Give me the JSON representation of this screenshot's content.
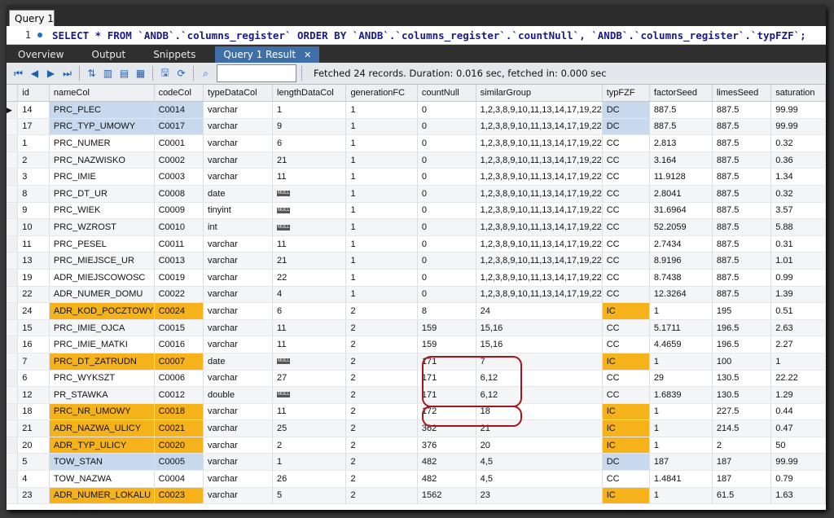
{
  "editor": {
    "tab_label": "Query 1",
    "line_number": "1",
    "sql": "SELECT * FROM `ANDB`.`columns_register` ORDER BY `ANDB`.`columns_register`.`countNull`, `ANDB`.`columns_register`.`typFZF`;"
  },
  "result_tabs": [
    "Overview",
    "Output",
    "Snippets"
  ],
  "active_result_tab": "Query 1 Result",
  "status": "Fetched 24 records. Duration: 0.016 sec, fetched in: 0.000 sec",
  "search": {
    "value": ""
  },
  "columns": [
    "id",
    "nameCol",
    "codeCol",
    "typeDataCol",
    "lengthDataCol",
    "generationFC",
    "countNull",
    "similarGroup",
    "typFZF",
    "factorSeed",
    "limesSeed",
    "saturation"
  ],
  "null_label": "NULL",
  "colors": {
    "highlight_blue": "#c8d9ee",
    "highlight_orange": "#f6b21a",
    "circle_red": "#a9141b"
  },
  "rows": [
    {
      "id": "14",
      "nameCol": "PRC_PLEC",
      "codeCol": "C0014",
      "typeDataCol": "varchar",
      "lengthDataCol": "1",
      "generationFC": "1",
      "countNull": "0",
      "similarGroup": "1,2,3,8,9,10,11,13,14,17,19,22",
      "typFZF": "DC",
      "factorSeed": "887.5",
      "limesSeed": "887.5",
      "saturation": "99.99",
      "hl": "blue"
    },
    {
      "id": "17",
      "nameCol": "PRC_TYP_UMOWY",
      "codeCol": "C0017",
      "typeDataCol": "varchar",
      "lengthDataCol": "9",
      "generationFC": "1",
      "countNull": "0",
      "similarGroup": "1,2,3,8,9,10,11,13,14,17,19,22",
      "typFZF": "DC",
      "factorSeed": "887.5",
      "limesSeed": "887.5",
      "saturation": "99.99",
      "hl": "blue"
    },
    {
      "id": "1",
      "nameCol": "PRC_NUMER",
      "codeCol": "C0001",
      "typeDataCol": "varchar",
      "lengthDataCol": "6",
      "generationFC": "1",
      "countNull": "0",
      "similarGroup": "1,2,3,8,9,10,11,13,14,17,19,22",
      "typFZF": "CC",
      "factorSeed": "2.813",
      "limesSeed": "887.5",
      "saturation": "0.32",
      "hl": ""
    },
    {
      "id": "2",
      "nameCol": "PRC_NAZWISKO",
      "codeCol": "C0002",
      "typeDataCol": "varchar",
      "lengthDataCol": "21",
      "generationFC": "1",
      "countNull": "0",
      "similarGroup": "1,2,3,8,9,10,11,13,14,17,19,22",
      "typFZF": "CC",
      "factorSeed": "3.164",
      "limesSeed": "887.5",
      "saturation": "0.36",
      "hl": ""
    },
    {
      "id": "3",
      "nameCol": "PRC_IMIE",
      "codeCol": "C0003",
      "typeDataCol": "varchar",
      "lengthDataCol": "11",
      "generationFC": "1",
      "countNull": "0",
      "similarGroup": "1,2,3,8,9,10,11,13,14,17,19,22",
      "typFZF": "CC",
      "factorSeed": "11.9128",
      "limesSeed": "887.5",
      "saturation": "1.34",
      "hl": ""
    },
    {
      "id": "8",
      "nameCol": "PRC_DT_UR",
      "codeCol": "C0008",
      "typeDataCol": "date",
      "lengthDataCol": null,
      "generationFC": "1",
      "countNull": "0",
      "similarGroup": "1,2,3,8,9,10,11,13,14,17,19,22",
      "typFZF": "CC",
      "factorSeed": "2.8041",
      "limesSeed": "887.5",
      "saturation": "0.32",
      "hl": ""
    },
    {
      "id": "9",
      "nameCol": "PRC_WIEK",
      "codeCol": "C0009",
      "typeDataCol": "tinyint",
      "lengthDataCol": null,
      "generationFC": "1",
      "countNull": "0",
      "similarGroup": "1,2,3,8,9,10,11,13,14,17,19,22",
      "typFZF": "CC",
      "factorSeed": "31.6964",
      "limesSeed": "887.5",
      "saturation": "3.57",
      "hl": ""
    },
    {
      "id": "10",
      "nameCol": "PRC_WZROST",
      "codeCol": "C0010",
      "typeDataCol": "int",
      "lengthDataCol": null,
      "generationFC": "1",
      "countNull": "0",
      "similarGroup": "1,2,3,8,9,10,11,13,14,17,19,22",
      "typFZF": "CC",
      "factorSeed": "52.2059",
      "limesSeed": "887.5",
      "saturation": "5.88",
      "hl": ""
    },
    {
      "id": "11",
      "nameCol": "PRC_PESEL",
      "codeCol": "C0011",
      "typeDataCol": "varchar",
      "lengthDataCol": "11",
      "generationFC": "1",
      "countNull": "0",
      "similarGroup": "1,2,3,8,9,10,11,13,14,17,19,22",
      "typFZF": "CC",
      "factorSeed": "2.7434",
      "limesSeed": "887.5",
      "saturation": "0.31",
      "hl": ""
    },
    {
      "id": "13",
      "nameCol": "PRC_MIEJSCE_UR",
      "codeCol": "C0013",
      "typeDataCol": "varchar",
      "lengthDataCol": "21",
      "generationFC": "1",
      "countNull": "0",
      "similarGroup": "1,2,3,8,9,10,11,13,14,17,19,22",
      "typFZF": "CC",
      "factorSeed": "8.9196",
      "limesSeed": "887.5",
      "saturation": "1.01",
      "hl": ""
    },
    {
      "id": "19",
      "nameCol": "ADR_MIEJSCOWOSC",
      "codeCol": "C0019",
      "typeDataCol": "varchar",
      "lengthDataCol": "22",
      "generationFC": "1",
      "countNull": "0",
      "similarGroup": "1,2,3,8,9,10,11,13,14,17,19,22",
      "typFZF": "CC",
      "factorSeed": "8.7438",
      "limesSeed": "887.5",
      "saturation": "0.99",
      "hl": ""
    },
    {
      "id": "22",
      "nameCol": "ADR_NUMER_DOMU",
      "codeCol": "C0022",
      "typeDataCol": "varchar",
      "lengthDataCol": "4",
      "generationFC": "1",
      "countNull": "0",
      "similarGroup": "1,2,3,8,9,10,11,13,14,17,19,22",
      "typFZF": "CC",
      "factorSeed": "12.3264",
      "limesSeed": "887.5",
      "saturation": "1.39",
      "hl": ""
    },
    {
      "id": "24",
      "nameCol": "ADR_KOD_POCZTOWY",
      "codeCol": "C0024",
      "typeDataCol": "varchar",
      "lengthDataCol": "6",
      "generationFC": "2",
      "countNull": "8",
      "similarGroup": "24",
      "typFZF": "IC",
      "factorSeed": "1",
      "limesSeed": "195",
      "saturation": "0.51",
      "hl": "orange"
    },
    {
      "id": "15",
      "nameCol": "PRC_IMIE_OJCA",
      "codeCol": "C0015",
      "typeDataCol": "varchar",
      "lengthDataCol": "11",
      "generationFC": "2",
      "countNull": "159",
      "similarGroup": "15,16",
      "typFZF": "CC",
      "factorSeed": "5.1711",
      "limesSeed": "196.5",
      "saturation": "2.63",
      "hl": ""
    },
    {
      "id": "16",
      "nameCol": "PRC_IMIE_MATKI",
      "codeCol": "C0016",
      "typeDataCol": "varchar",
      "lengthDataCol": "11",
      "generationFC": "2",
      "countNull": "159",
      "similarGroup": "15,16",
      "typFZF": "CC",
      "factorSeed": "4.4659",
      "limesSeed": "196.5",
      "saturation": "2.27",
      "hl": ""
    },
    {
      "id": "7",
      "nameCol": "PRC_DT_ZATRUDN",
      "codeCol": "C0007",
      "typeDataCol": "date",
      "lengthDataCol": null,
      "generationFC": "2",
      "countNull": "171",
      "similarGroup": "7",
      "typFZF": "IC",
      "factorSeed": "1",
      "limesSeed": "100",
      "saturation": "1",
      "hl": "orange"
    },
    {
      "id": "6",
      "nameCol": "PRC_WYKSZT",
      "codeCol": "C0006",
      "typeDataCol": "varchar",
      "lengthDataCol": "27",
      "generationFC": "2",
      "countNull": "171",
      "similarGroup": "6,12",
      "typFZF": "CC",
      "factorSeed": "29",
      "limesSeed": "130.5",
      "saturation": "22.22",
      "hl": ""
    },
    {
      "id": "12",
      "nameCol": "PR_STAWKA",
      "codeCol": "C0012",
      "typeDataCol": "double",
      "lengthDataCol": null,
      "generationFC": "2",
      "countNull": "171",
      "similarGroup": "6,12",
      "typFZF": "CC",
      "factorSeed": "1.6839",
      "limesSeed": "130.5",
      "saturation": "1.29",
      "hl": ""
    },
    {
      "id": "18",
      "nameCol": "PRC_NR_UMOWY",
      "codeCol": "C0018",
      "typeDataCol": "varchar",
      "lengthDataCol": "11",
      "generationFC": "2",
      "countNull": "172",
      "similarGroup": "18",
      "typFZF": "IC",
      "factorSeed": "1",
      "limesSeed": "227.5",
      "saturation": "0.44",
      "hl": "orange"
    },
    {
      "id": "21",
      "nameCol": "ADR_NAZWA_ULICY",
      "codeCol": "C0021",
      "typeDataCol": "varchar",
      "lengthDataCol": "25",
      "generationFC": "2",
      "countNull": "362",
      "similarGroup": "21",
      "typFZF": "IC",
      "factorSeed": "1",
      "limesSeed": "214.5",
      "saturation": "0.47",
      "hl": "orange"
    },
    {
      "id": "20",
      "nameCol": "ADR_TYP_ULICY",
      "codeCol": "C0020",
      "typeDataCol": "varchar",
      "lengthDataCol": "2",
      "generationFC": "2",
      "countNull": "376",
      "similarGroup": "20",
      "typFZF": "IC",
      "factorSeed": "1",
      "limesSeed": "2",
      "saturation": "50",
      "hl": "orange"
    },
    {
      "id": "5",
      "nameCol": "TOW_STAN",
      "codeCol": "C0005",
      "typeDataCol": "varchar",
      "lengthDataCol": "1",
      "generationFC": "2",
      "countNull": "482",
      "similarGroup": "4,5",
      "typFZF": "DC",
      "factorSeed": "187",
      "limesSeed": "187",
      "saturation": "99.99",
      "hl": "blue"
    },
    {
      "id": "4",
      "nameCol": "TOW_NAZWA",
      "codeCol": "C0004",
      "typeDataCol": "varchar",
      "lengthDataCol": "26",
      "generationFC": "2",
      "countNull": "482",
      "similarGroup": "4,5",
      "typFZF": "CC",
      "factorSeed": "1.4841",
      "limesSeed": "187",
      "saturation": "0.79",
      "hl": ""
    },
    {
      "id": "23",
      "nameCol": "ADR_NUMER_LOKALU",
      "codeCol": "C0023",
      "typeDataCol": "varchar",
      "lengthDataCol": "5",
      "generationFC": "2",
      "countNull": "1562",
      "similarGroup": "23",
      "typFZF": "IC",
      "factorSeed": "1",
      "limesSeed": "61.5",
      "saturation": "1.63",
      "hl": "orange"
    }
  ]
}
